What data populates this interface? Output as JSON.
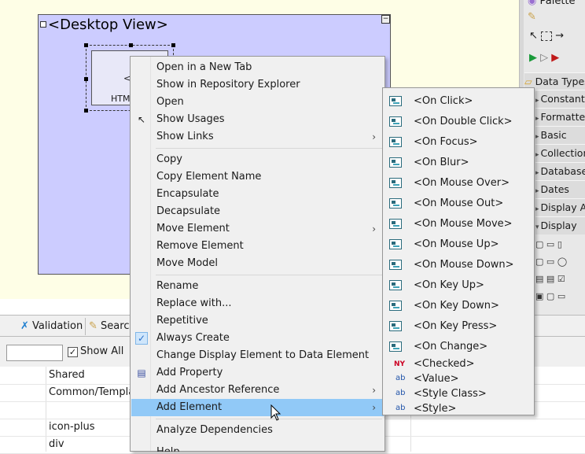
{
  "canvas": {
    "desktop_view_title": "<Desktop View>",
    "html_element_label": "HTM",
    "html_element_bracket": "<"
  },
  "palette": {
    "title": "Palette",
    "rows": [
      "Data Types",
      "Constants",
      "Formatted",
      "Basic",
      "Collections",
      "Database",
      "Dates",
      "Display Ac",
      "Display"
    ]
  },
  "bottom": {
    "tabs": [
      "Validation",
      "Search"
    ],
    "show_all_label": "Show All",
    "show_all_checked": "✓",
    "table_rows": [
      "Shared",
      "Common/Templa",
      "",
      "icon-plus",
      "div"
    ]
  },
  "context_menu": {
    "items": [
      {
        "label": "Open in a New Tab"
      },
      {
        "label": "Show in Repository Explorer"
      },
      {
        "label": "Open"
      },
      {
        "label": "Show Usages"
      },
      {
        "label": "Show Links",
        "submenu": "›"
      },
      {
        "label": "Copy"
      },
      {
        "label": "Copy Element Name"
      },
      {
        "label": "Encapsulate"
      },
      {
        "label": "Decapsulate"
      },
      {
        "label": "Move Element",
        "submenu": "›"
      },
      {
        "label": "Remove Element"
      },
      {
        "label": "Move Model"
      },
      {
        "label": "Rename"
      },
      {
        "label": "Replace with..."
      },
      {
        "label": "Repetitive"
      },
      {
        "label": "Always Create",
        "checked": "✓"
      },
      {
        "label": "Change Display Element to Data Element"
      },
      {
        "label": "Add Property"
      },
      {
        "label": "Add Ancestor Reference",
        "submenu": "›"
      },
      {
        "label": "Add Element",
        "submenu": "›"
      },
      {
        "label": "Analyze Dependencies"
      },
      {
        "label": "Help"
      }
    ]
  },
  "add_element_submenu": {
    "items": [
      "<On Click>",
      "<On Double Click>",
      "<On Focus>",
      "<On Blur>",
      "<On Mouse Over>",
      "<On Mouse Out>",
      "<On Mouse Move>",
      "<On Mouse Up>",
      "<On Mouse Down>",
      "<On Key Up>",
      "<On Key Down>",
      "<On Key Press>",
      "<On Change>",
      "<Checked>",
      "<Value>",
      "<Style Class>",
      "<Style>"
    ],
    "icons": {
      "checked": "NY",
      "text": "ab"
    }
  },
  "colors": {
    "canvas_bg": "#fefee6",
    "desktop_view_bg": "#ccccff",
    "menu_highlight": "#91c9f7"
  }
}
